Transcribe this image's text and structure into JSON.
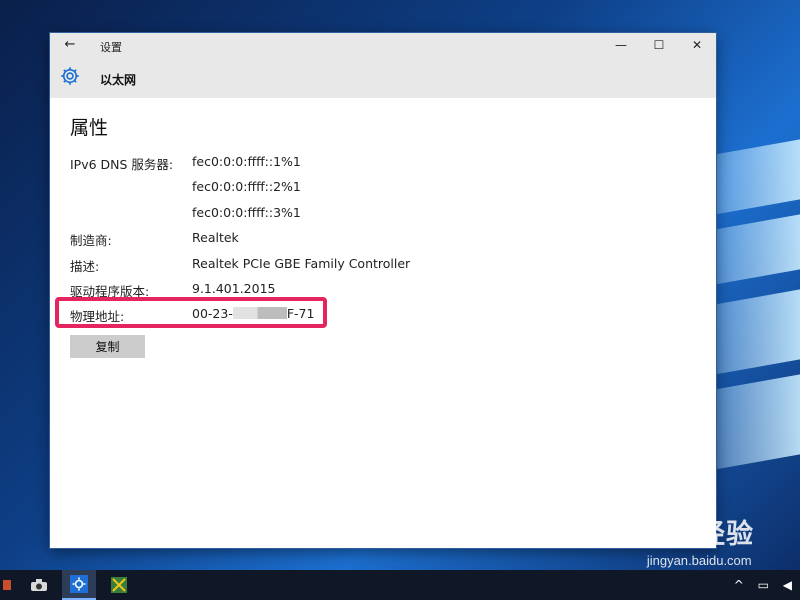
{
  "window": {
    "title": "设置",
    "page_name": "以太网",
    "controls": {
      "back": "←",
      "minimize": "—",
      "maximize": "☐",
      "close": "✕"
    }
  },
  "properties": {
    "section_title": "属性",
    "rows": [
      {
        "label": "IPv6 DNS 服务器:",
        "value": "fec0:0:0:ffff::1%1"
      },
      {
        "label": "",
        "value": "fec0:0:0:ffff::2%1"
      },
      {
        "label": "",
        "value": "fec0:0:0:ffff::3%1"
      },
      {
        "label": "制造商:",
        "value": "Realtek"
      },
      {
        "label": "描述:",
        "value": "Realtek PCIe GBE Family Controller"
      },
      {
        "label": "驱动程序版本:",
        "value": "9.1.401.2015"
      }
    ],
    "physical_address": {
      "label": "物理地址:",
      "value_start": "00-23-",
      "value_end": "F-71"
    },
    "copy_button": "复制"
  },
  "watermark": {
    "logo": "Bai 经验",
    "url": "jingyan.baidu.com"
  },
  "colors": {
    "highlight": "#e6245f",
    "accent": "#1e6fd0"
  }
}
